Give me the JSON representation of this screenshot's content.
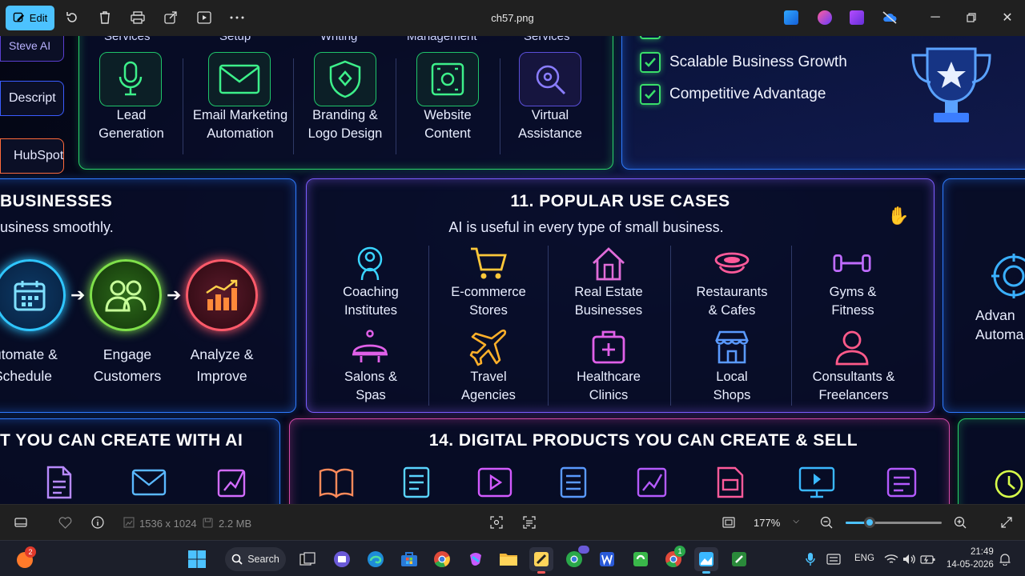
{
  "titlebar": {
    "edit_label": "Edit",
    "file_name": "ch57.png"
  },
  "poster": {
    "left_sidebar": [
      "Steve AI",
      "Descript",
      "HubSpot"
    ],
    "top_panel": {
      "cut_labels": [
        "Services",
        "Setup",
        "Writing",
        "Management",
        "Services"
      ],
      "items": [
        {
          "label": "Lead\nGeneration",
          "l1": "Lead",
          "l2": "Generation",
          "icon": "microphone-icon"
        },
        {
          "label": "Email Marketing Automation",
          "l1": "Email Marketing",
          "l2": "Automation",
          "icon": "envelope-icon"
        },
        {
          "label": "Branding & Logo Design",
          "l1": "Branding &",
          "l2": "Logo Design",
          "icon": "shield-icon"
        },
        {
          "label": "Website Content",
          "l1": "Website",
          "l2": "Content",
          "icon": "scan-icon"
        },
        {
          "label": "Virtual Assistance",
          "l1": "Virtual",
          "l2": "Assistance",
          "icon": "magnifier-icon"
        }
      ]
    },
    "benefits": [
      "Scalable Business Growth",
      "Competitive Advantage"
    ],
    "businesses_panel": {
      "title": "BUSINESSES",
      "subtitle": "usiness smoothly.",
      "steps": [
        {
          "l1": "utomate &",
          "l2": "Schedule"
        },
        {
          "l1": "Engage",
          "l2": "Customers"
        },
        {
          "l1": "Analyze &",
          "l2": "Improve"
        }
      ]
    },
    "use_cases": {
      "title": "11. POPULAR USE CASES",
      "subtitle": "AI is useful in every type of small business.",
      "items": [
        {
          "l1": "Coaching",
          "l2": "Institutes",
          "icon": "person-icon"
        },
        {
          "l1": "E-commerce",
          "l2": "Stores",
          "icon": "cart-icon"
        },
        {
          "l1": "Real Estate",
          "l2": "Businesses",
          "icon": "house-icon"
        },
        {
          "l1": "Restaurants",
          "l2": "& Cafes",
          "icon": "dish-icon"
        },
        {
          "l1": "Gyms &",
          "l2": "Fitness",
          "icon": "dumbbell-icon"
        },
        {
          "l1": "Salons &",
          "l2": "Spas",
          "icon": "salon-icon"
        },
        {
          "l1": "Travel",
          "l2": "Agencies",
          "icon": "airplane-icon"
        },
        {
          "l1": "Healthcare",
          "l2": "Clinics",
          "icon": "medkit-icon"
        },
        {
          "l1": "Local",
          "l2": "Shops",
          "icon": "shop-icon"
        },
        {
          "l1": "Consultants &",
          "l2": "Freelancers",
          "icon": "user-icon"
        }
      ]
    },
    "right_cut": {
      "l1": "Advan",
      "l2": "Automa"
    },
    "create_panel": {
      "title": "T YOU CAN CREATE WITH AI"
    },
    "digital_panel": {
      "title": "14. DIGITAL PRODUCTS YOU CAN CREATE & SELL"
    }
  },
  "statusbar": {
    "dimensions": "1536 x 1024",
    "file_size": "2.2 MB",
    "zoom": "177%",
    "zoom_fraction": 0.25
  },
  "taskbar": {
    "search_label": "Search",
    "notification_count": "2",
    "badge_count": "1",
    "language": "ENG",
    "time": "21:49",
    "date": "14-05-2026"
  },
  "colors": {
    "accent": "#4cc2ff",
    "green": "#2ad46a",
    "blue": "#2f7bff",
    "purple": "#7a5cff",
    "pink": "#d24aa8"
  }
}
